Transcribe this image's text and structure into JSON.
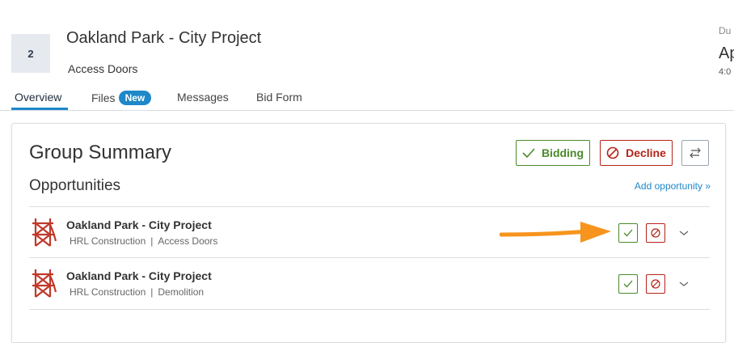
{
  "header": {
    "number": "2",
    "project_title": "Oakland Park - City Project",
    "subtitle": "Access Doors",
    "due_label": "Du",
    "due_date": "Ap",
    "due_time": "4:0"
  },
  "tabs": [
    {
      "label": "Overview",
      "active": true
    },
    {
      "label": "Files",
      "pill": "New"
    },
    {
      "label": "Messages"
    },
    {
      "label": "Bid Form"
    }
  ],
  "summary": {
    "title": "Group Summary",
    "opportunities_title": "Opportunities",
    "add_link": "Add opportunity »",
    "bidding_label": "Bidding",
    "decline_label": "Decline"
  },
  "opportunities": [
    {
      "name": "Oakland Park - City Project",
      "company": "HRL Construction",
      "separator": "|",
      "trade": "Access Doors"
    },
    {
      "name": "Oakland Park - City Project",
      "company": "HRL Construction",
      "separator": "|",
      "trade": "Demolition"
    }
  ],
  "colors": {
    "accent": "#1e88c8",
    "accept": "#4a8a2a",
    "decline": "#b42318",
    "annotation_arrow": "#f7941d",
    "logo": "#c0392b"
  },
  "icons": {
    "bidding": "check-icon",
    "decline": "block-icon",
    "swap": "swap-arrows-icon",
    "expand": "chevron-down-icon",
    "logo": "bridge-logo-icon"
  }
}
